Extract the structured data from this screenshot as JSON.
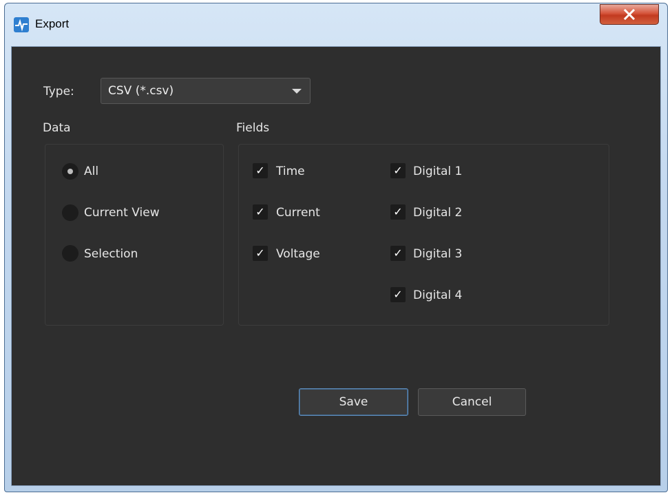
{
  "window": {
    "title": "Export",
    "accent": "#2e7fd0",
    "close_label": "x"
  },
  "type": {
    "label": "Type:",
    "value": "CSV (*.csv)"
  },
  "data_group": {
    "label": "Data",
    "options": [
      {
        "label": "All",
        "checked": true
      },
      {
        "label": "Current View",
        "checked": false
      },
      {
        "label": "Selection",
        "checked": false
      }
    ]
  },
  "fields_group": {
    "label": "Fields",
    "left": [
      {
        "label": "Time",
        "checked": true
      },
      {
        "label": "Current",
        "checked": true
      },
      {
        "label": "Voltage",
        "checked": true
      }
    ],
    "right": [
      {
        "label": "Digital 1",
        "checked": true
      },
      {
        "label": "Digital 2",
        "checked": true
      },
      {
        "label": "Digital 3",
        "checked": true
      },
      {
        "label": "Digital 4",
        "checked": true
      }
    ]
  },
  "buttons": {
    "save": "Save",
    "cancel": "Cancel"
  },
  "check_glyph": "✓"
}
